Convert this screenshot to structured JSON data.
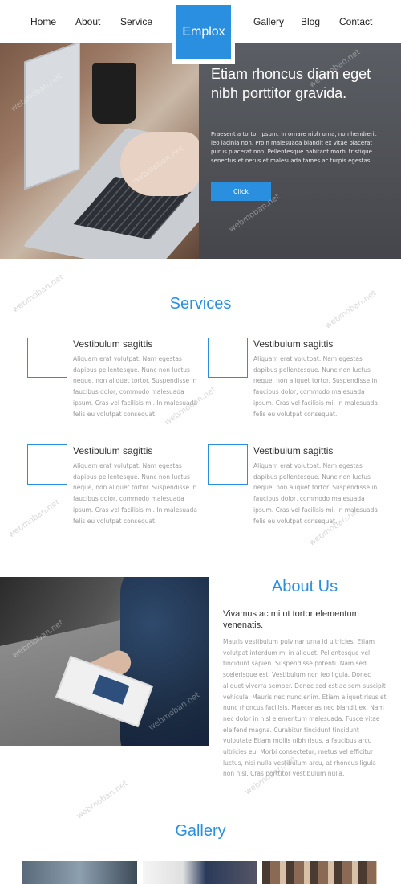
{
  "nav": {
    "left": [
      "Home",
      "About",
      "Service"
    ],
    "right": [
      "Gallery",
      "Blog",
      "Contact"
    ],
    "logo": "Emplox"
  },
  "hero": {
    "title": "Etiam rhoncus diam eget nibh porttitor gravida.",
    "text": "Praesent a tortor ipsum. In ornare nibh urna, non hendrerit leo lacinia non. Proin malesuada blandit ex vitae placerat purus placerat non. Pellentesque habitant morbi tristique senectus et netus et malesuada fames ac turpis egestas.",
    "button": "Click"
  },
  "services": {
    "title": "Services",
    "items": [
      {
        "title": "Vestibulum sagittis",
        "text": "Aliquam erat volutpat. Nam egestas dapibus pellentesque. Nunc non luctus neque, non aliquet tortor. Suspendisse in faucibus dolor, commodo malesuada ipsum. Cras vel facilisis mi. In malesuada felis eu volutpat consequat."
      },
      {
        "title": "Vestibulum sagittis",
        "text": "Aliquam erat volutpat. Nam egestas dapibus pellentesque. Nunc non luctus neque, non aliquet tortor. Suspendisse in faucibus dolor, commodo malesuada ipsum. Cras vel facilisis mi. In malesuada felis eu volutpat consequat."
      },
      {
        "title": "Vestibulum sagittis",
        "text": "Aliquam erat volutpat. Nam egestas dapibus pellentesque. Nunc non luctus neque, non aliquet tortor. Suspendisse in faucibus dolor, commodo malesuada ipsum. Cras vel facilisis mi. In malesuada felis eu volutpat consequat."
      },
      {
        "title": "Vestibulum sagittis",
        "text": "Aliquam erat volutpat. Nam egestas dapibus pellentesque. Nunc non luctus neque, non aliquet tortor. Suspendisse in faucibus dolor, commodo malesuada ipsum. Cras vel facilisis mi. In malesuada felis eu volutpat consequat."
      }
    ]
  },
  "about": {
    "title": "About Us",
    "subtitle": "Vivamus ac mi ut tortor elementum venenatis.",
    "text": "Mauris vestibulum pulvinar urna id ultricies. Etiam volutpat interdum mi in aliquet. Pellentesque vel tincidunt sapien. Suspendisse potenti. Nam sed scelerisque est. Vestibulum non leo ligula. Donec aliquet viverra semper. Donec sed est ac sem suscipit vehicula. Mauris nec nunc enim. Etiam aliquet risus et nunc rhoncus facilisis. Maecenas nec blandit ex. Nam nec dolor in nisl elementum malesuada. Fusce vitae eleifend magna. Curabitur tincidunt tincidunt vulputate Etiam mollis nibh risus, a faucibus arcu ultricies eu. Morbi consectetur, metus vel efficitur luctus, nisi nulla vestibulum arcu, at rhoncus ligula non nisl. Cras porttitor vestibulum nulla."
  },
  "gallery": {
    "title": "Gallery"
  },
  "watermark": "webmoban.net",
  "colors": {
    "accent": "#2b8fe0"
  }
}
